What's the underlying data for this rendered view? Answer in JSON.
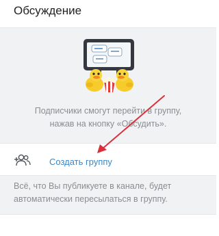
{
  "header": {
    "title": "Обсуждение"
  },
  "empty_state": {
    "lines": [
      "Подписчики смогут перейти в группу,",
      "нажав на кнопку «Обсудить»."
    ]
  },
  "action": {
    "label": "Создать группу",
    "icon": "add-group-icon"
  },
  "footer": {
    "lines": [
      "Всё, что Вы публикуете в канале, будет",
      "автоматически пересылаться в группу."
    ]
  },
  "annotation": {
    "arrow_color": "#d9303a"
  },
  "colors": {
    "accent": "#3a86c5",
    "muted_text": "#8a8c90",
    "section_bg": "#f1f2f4"
  }
}
